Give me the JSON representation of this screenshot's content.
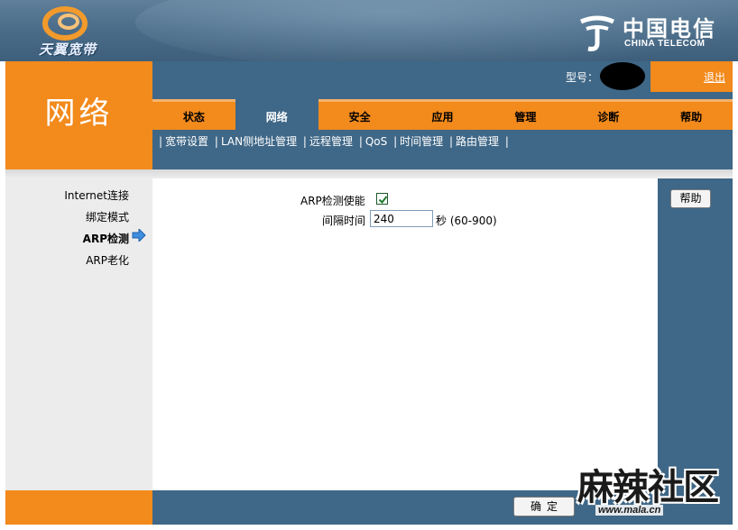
{
  "brand": {
    "logo_text": "天翼宽带",
    "telecom_cn": "中国电信",
    "telecom_en": "CHINA TELECOM"
  },
  "section": {
    "title": "网络"
  },
  "topbar": {
    "model_label": "型号：",
    "logout_label": "退出"
  },
  "tabs": [
    {
      "label": "状态",
      "active": false
    },
    {
      "label": "网络",
      "active": true
    },
    {
      "label": "安全",
      "active": false
    },
    {
      "label": "应用",
      "active": false
    },
    {
      "label": "管理",
      "active": false
    },
    {
      "label": "诊断",
      "active": false
    },
    {
      "label": "帮助",
      "active": false
    }
  ],
  "submenu": [
    "宽带设置",
    "LAN侧地址管理",
    "远程管理",
    "QoS",
    "时间管理",
    "路由管理"
  ],
  "leftnav": [
    {
      "label": "Internet连接",
      "active": false
    },
    {
      "label": "绑定模式",
      "active": false
    },
    {
      "label": "ARP检测",
      "active": true
    },
    {
      "label": "ARP老化",
      "active": false
    }
  ],
  "form": {
    "enable_label": "ARP检测使能",
    "enable_checked": true,
    "interval_label": "间隔时间",
    "interval_value": "240",
    "interval_unit": "秒 (60-900)"
  },
  "help": {
    "button_label": "帮助"
  },
  "footer": {
    "confirm_label": "确定"
  },
  "watermark": {
    "text": "麻辣社区",
    "url": "www.mala.cn"
  },
  "colors": {
    "orange": "#f28a1c",
    "blue": "#3f6787",
    "header_blue": "#4a6c88"
  }
}
